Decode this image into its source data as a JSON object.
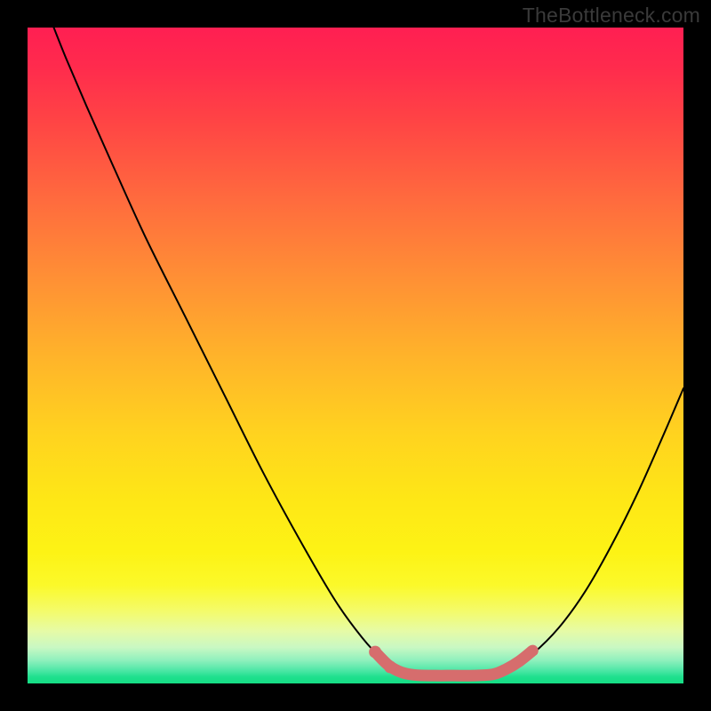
{
  "watermark": "TheBottleneck.com",
  "chart_data": {
    "type": "line",
    "title": "",
    "xlabel": "",
    "ylabel": "",
    "xlim": [
      0,
      100
    ],
    "ylim": [
      0,
      100
    ],
    "grid": false,
    "series": [
      {
        "name": "left-curve",
        "color": "#000000",
        "stroke_width": 2,
        "points": [
          {
            "x": 4.0,
            "y": 100.0
          },
          {
            "x": 6.0,
            "y": 95.0
          },
          {
            "x": 9.0,
            "y": 88.0
          },
          {
            "x": 13.0,
            "y": 79.0
          },
          {
            "x": 18.0,
            "y": 68.0
          },
          {
            "x": 24.0,
            "y": 56.0
          },
          {
            "x": 30.0,
            "y": 44.0
          },
          {
            "x": 36.0,
            "y": 32.0
          },
          {
            "x": 42.0,
            "y": 21.0
          },
          {
            "x": 47.0,
            "y": 12.5
          },
          {
            "x": 51.0,
            "y": 7.0
          },
          {
            "x": 54.0,
            "y": 3.8
          },
          {
            "x": 56.5,
            "y": 2.2
          },
          {
            "x": 59.0,
            "y": 1.4
          }
        ]
      },
      {
        "name": "right-curve",
        "color": "#000000",
        "stroke_width": 2,
        "points": [
          {
            "x": 71.0,
            "y": 1.4
          },
          {
            "x": 74.0,
            "y": 2.5
          },
          {
            "x": 77.0,
            "y": 4.5
          },
          {
            "x": 81.0,
            "y": 8.5
          },
          {
            "x": 85.0,
            "y": 14.0
          },
          {
            "x": 89.0,
            "y": 21.0
          },
          {
            "x": 93.0,
            "y": 29.0
          },
          {
            "x": 97.0,
            "y": 38.0
          },
          {
            "x": 100.0,
            "y": 45.0
          }
        ]
      },
      {
        "name": "highlight-segment",
        "color": "#d66d6d",
        "stroke_width": 13,
        "points": [
          {
            "x": 53.0,
            "y": 4.8
          },
          {
            "x": 55.0,
            "y": 2.8
          },
          {
            "x": 57.0,
            "y": 1.7
          },
          {
            "x": 59.0,
            "y": 1.3
          },
          {
            "x": 62.0,
            "y": 1.2
          },
          {
            "x": 65.0,
            "y": 1.2
          },
          {
            "x": 68.0,
            "y": 1.2
          },
          {
            "x": 71.0,
            "y": 1.4
          },
          {
            "x": 73.0,
            "y": 2.2
          },
          {
            "x": 75.0,
            "y": 3.4
          },
          {
            "x": 77.0,
            "y": 5.0
          }
        ]
      }
    ],
    "markers": [
      {
        "name": "dot-1",
        "x": 53.0,
        "y": 4.8,
        "r": 7,
        "color": "#d66d6d"
      },
      {
        "name": "dot-2",
        "x": 55.3,
        "y": 2.5,
        "r": 7,
        "color": "#d66d6d"
      }
    ]
  }
}
